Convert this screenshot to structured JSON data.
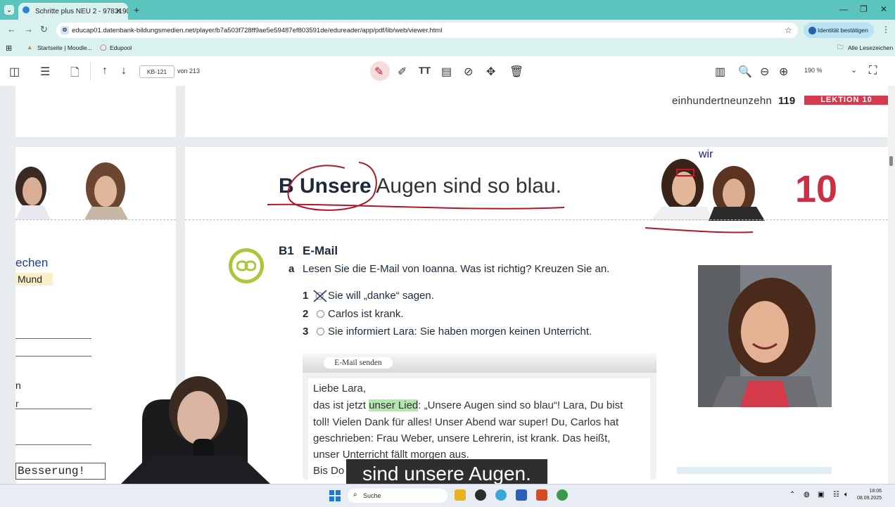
{
  "browser": {
    "tab_title": "Schritte plus NEU 2 - 9783190",
    "tab_close": "✕",
    "new_tab": "+",
    "url": "educap01.datenbank-bildungsmedien.net/player/b7a503f728ff9ae5e59487ef803591de/edureader/app/pdf/lib/web/viewer.html",
    "identity_button": "Identität bestätigen",
    "bookmarks": [
      "Startseite | Moodle...",
      "Edupool"
    ],
    "all_bookmarks": "Alle Lesezeichen"
  },
  "viewer": {
    "page_input": "KB-121",
    "page_count": "von 213",
    "zoom": "190 %"
  },
  "document": {
    "running_head_text": "einhundertneunzehn",
    "running_head_number": "119",
    "lektion_badge": "LEKTION 10",
    "section_letter": "B",
    "headline_bold": "Unsere",
    "headline_rest": "Augen sind so blau.",
    "lesson_number": "10",
    "annotation_wir": "wir",
    "b1_label": "B1",
    "b1_title": "E-Mail",
    "a_label": "a",
    "a_instruction": "Lesen Sie die E-Mail von Ioanna. Was ist richtig? Kreuzen Sie an.",
    "items": [
      {
        "num": "1",
        "text": "Sie will „danke“ sagen."
      },
      {
        "num": "2",
        "text": "Carlos ist krank."
      },
      {
        "num": "3",
        "text": "Sie informiert Lara: Sie haben morgen keinen Unterricht."
      }
    ],
    "email_send_button": "E-Mail senden",
    "email_greeting": "Liebe Lara,",
    "email_line1_pre": "das ist jetzt ",
    "email_line1_highlight": "unser Lied",
    "email_line1_post": ": „Unsere Augen sind so blau“! Lara, Du bist",
    "email_line2": "toll! Vielen Dank für alles! Unser Abend war super! Du, Carlos hat",
    "email_line3": "geschrieben: Frau Weber, unsere Lehrerin, ist krank. Das heißt,",
    "email_line4": "unser Unterricht fällt morgen aus.",
    "email_line5": "Bis Do"
  },
  "left_page": {
    "frag_echen": "echen",
    "frag_mund": "Mund",
    "frag_n": "n",
    "frag_r": "r",
    "besserung": "Besserung!"
  },
  "subtitle": "sind unsere Augen.",
  "taskbar": {
    "search_placeholder": "Suche",
    "time": "18:06",
    "date": "08.09.2025"
  },
  "colors": {
    "browser_teal": "#5bc4bc",
    "lektion_red": "#d63a4e",
    "annotation_red": "#b0182a",
    "link_green": "#a8c83a"
  }
}
